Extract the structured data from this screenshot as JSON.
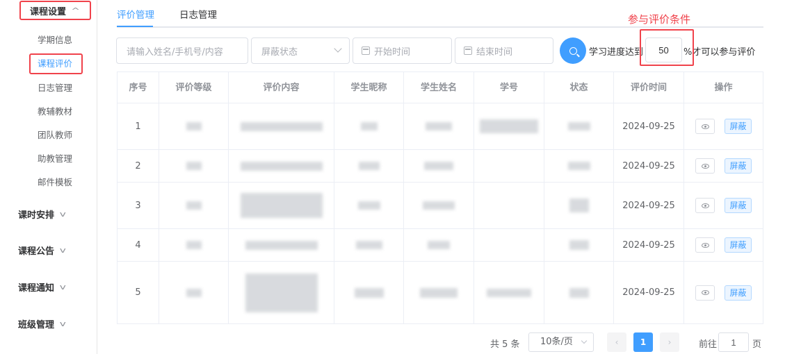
{
  "sidebar": {
    "groups": [
      {
        "label": "课程设置",
        "expanded": true
      },
      {
        "label": "课时安排",
        "expanded": false
      },
      {
        "label": "课程公告",
        "expanded": false
      },
      {
        "label": "课程通知",
        "expanded": false
      },
      {
        "label": "班级管理",
        "expanded": false
      }
    ],
    "items": [
      "学期信息",
      "课程评价",
      "日志管理",
      "教辅教材",
      "团队教师",
      "助教管理",
      "邮件模板"
    ],
    "active_item": "课程评价"
  },
  "tabs": [
    {
      "label": "评价管理",
      "active": true
    },
    {
      "label": "日志管理",
      "active": false
    }
  ],
  "annotation": "参与评价条件",
  "filters": {
    "search_placeholder": "请输入姓名/手机号/内容",
    "status_placeholder": "屏蔽状态",
    "start_placeholder": "开始时间",
    "end_placeholder": "结束时间",
    "progress_prefix": "学习进度达到",
    "progress_value": "50",
    "progress_suffix": "%才可以参与评价"
  },
  "table": {
    "columns": [
      "序号",
      "评价等级",
      "评价内容",
      "学生昵称",
      "学生姓名",
      "学号",
      "状态",
      "评价时间",
      "操作"
    ],
    "rows": [
      {
        "index": "1",
        "time": "2024-09-25"
      },
      {
        "index": "2",
        "time": "2024-09-25"
      },
      {
        "index": "3",
        "time": "2024-09-25"
      },
      {
        "index": "4",
        "time": "2024-09-25"
      },
      {
        "index": "5",
        "time": "2024-09-25"
      }
    ],
    "action_shield_label": "屏蔽"
  },
  "pagination": {
    "total": "共 5 条",
    "page_size": "10条/页",
    "prev": "‹",
    "current": "1",
    "next": "›",
    "goto_prefix": "前往",
    "goto_value": "1",
    "goto_suffix": "页"
  },
  "colors": {
    "accent": "#409eff",
    "highlight": "#f0424b"
  }
}
